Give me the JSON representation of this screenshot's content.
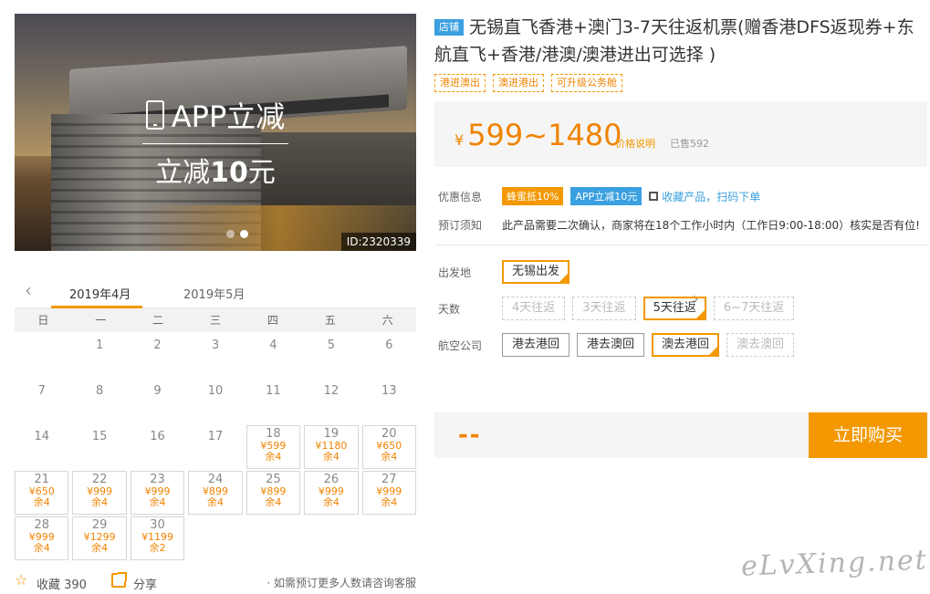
{
  "hero": {
    "promo_line1": "APP立减",
    "promo_line2_prefix": "立减",
    "promo_line2_amount": "10",
    "promo_line2_suffix": "元",
    "id_label": "ID:2320339"
  },
  "calendar": {
    "months": [
      "2019年4月",
      "2019年5月"
    ],
    "weekdays": [
      "日",
      "一",
      "二",
      "三",
      "四",
      "五",
      "六"
    ],
    "days": [
      {
        "d": "",
        "avail": false
      },
      {
        "d": "1",
        "avail": false
      },
      {
        "d": "2",
        "avail": false
      },
      {
        "d": "3",
        "avail": false
      },
      {
        "d": "4",
        "avail": false
      },
      {
        "d": "5",
        "avail": false
      },
      {
        "d": "6",
        "avail": false
      },
      {
        "d": "7",
        "avail": false
      },
      {
        "d": "8",
        "avail": false
      },
      {
        "d": "9",
        "avail": false
      },
      {
        "d": "10",
        "avail": false
      },
      {
        "d": "11",
        "avail": false
      },
      {
        "d": "12",
        "avail": false
      },
      {
        "d": "13",
        "avail": false
      },
      {
        "d": "14",
        "avail": false
      },
      {
        "d": "15",
        "avail": false
      },
      {
        "d": "16",
        "avail": false
      },
      {
        "d": "17",
        "avail": false
      },
      {
        "d": "18",
        "avail": true,
        "price": "¥599",
        "left": "余4"
      },
      {
        "d": "19",
        "avail": true,
        "price": "¥1180",
        "left": "余4"
      },
      {
        "d": "20",
        "avail": true,
        "price": "¥650",
        "left": "余4"
      },
      {
        "d": "21",
        "avail": true,
        "price": "¥650",
        "left": "余4"
      },
      {
        "d": "22",
        "avail": true,
        "price": "¥999",
        "left": "余4"
      },
      {
        "d": "23",
        "avail": true,
        "price": "¥999",
        "left": "余4"
      },
      {
        "d": "24",
        "avail": true,
        "price": "¥899",
        "left": "余4"
      },
      {
        "d": "25",
        "avail": true,
        "price": "¥899",
        "left": "余4"
      },
      {
        "d": "26",
        "avail": true,
        "price": "¥999",
        "left": "余4"
      },
      {
        "d": "27",
        "avail": true,
        "price": "¥999",
        "left": "余4"
      },
      {
        "d": "28",
        "avail": true,
        "price": "¥999",
        "left": "余4"
      },
      {
        "d": "29",
        "avail": true,
        "price": "¥1299",
        "left": "余4"
      },
      {
        "d": "30",
        "avail": true,
        "price": "¥1199",
        "left": "余2"
      }
    ]
  },
  "bottom": {
    "collect_label": "收藏 390",
    "share_label": "分享",
    "consult_label": "· 如需预订更多人数请咨询客服"
  },
  "product": {
    "shop_badge": "店铺",
    "title": "无锡直飞香港+澳门3-7天往返机票(赠香港DFS返现券+东航直飞+香港/港澳/澳港进出可选择 )",
    "tags": [
      "港进澳出",
      "澳进港出",
      "可升级公务舱"
    ],
    "price_symbol": "¥",
    "price_range": "599~1480",
    "price_note": "价格说明",
    "sold": "已售592"
  },
  "info": {
    "discount_label": "优惠信息",
    "discount_badge1": "蜂蜜抵10%",
    "discount_badge2": "APP立减10元",
    "collect_link": "收藏产品，扫码下单",
    "notice_label": "预订须知",
    "notice_text": "此产品需要二次确认，商家将在18个工作小时内（工作日9:00-18:00）核实是否有位!"
  },
  "options": {
    "departure_label": "出发地",
    "departure": [
      {
        "label": "无锡出发",
        "state": "sel"
      }
    ],
    "days_label": "天数",
    "days": [
      {
        "label": "4天往返",
        "state": "dis"
      },
      {
        "label": "3天往返",
        "state": "dis"
      },
      {
        "label": "5天往返",
        "state": "sel"
      },
      {
        "label": "6~7天往返",
        "state": "dis"
      }
    ],
    "airline_label": "航空公司",
    "airline": [
      {
        "label": "港去港回",
        "state": "norm"
      },
      {
        "label": "港去澳回",
        "state": "norm"
      },
      {
        "label": "澳去港回",
        "state": "sel"
      },
      {
        "label": "澳去澳回",
        "state": "dis"
      }
    ]
  },
  "buy": {
    "total": "--",
    "button": "立即购买"
  },
  "watermark": "eLvXing.net",
  "colors": {
    "accent": "#f39800",
    "blue": "#3aa0e0"
  }
}
